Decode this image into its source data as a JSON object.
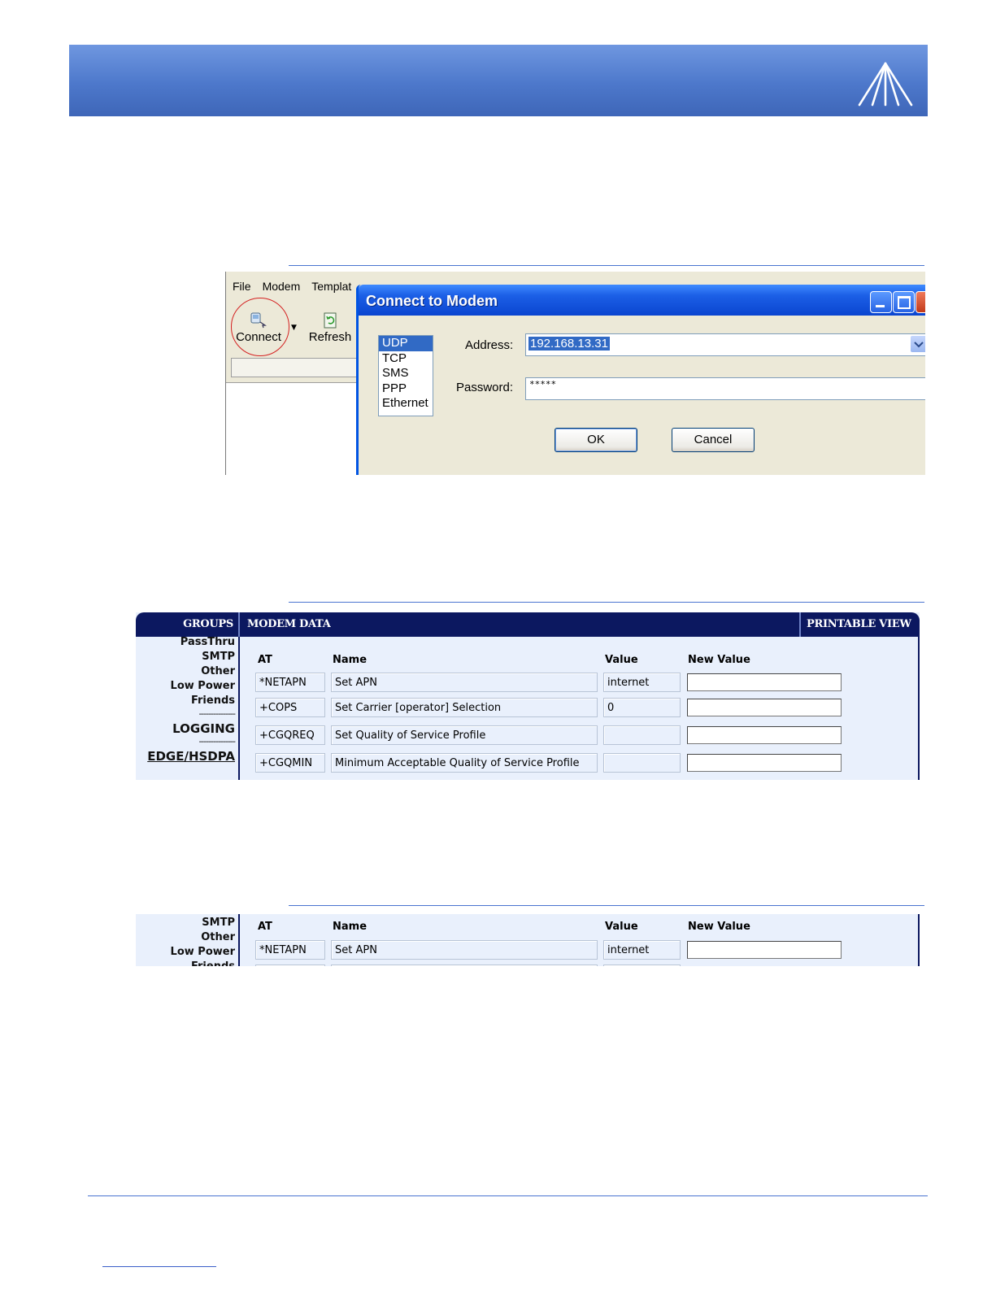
{
  "app": {
    "menu": [
      "File",
      "Modem",
      "Templat"
    ],
    "toolbar": {
      "connect_label": "Connect",
      "refresh_label": "Refresh"
    },
    "dialog": {
      "title": "Connect to Modem",
      "protocols": [
        "UDP",
        "TCP",
        "SMS",
        "PPP",
        "Ethernet"
      ],
      "selected_protocol": "UDP",
      "address_label": "Address:",
      "address_value": "192.168.13.31",
      "password_label": "Password:",
      "password_value": "*****",
      "ok_label": "OK",
      "cancel_label": "Cancel"
    }
  },
  "web1": {
    "header": {
      "groups": "GROUPS",
      "modem_data": "MODEM DATA",
      "printable_view": "PRINTABLE VIEW"
    },
    "sidebar": [
      "PassThru",
      "SMTP",
      "Other",
      "Low Power",
      "Friends"
    ],
    "separator": "---------------",
    "logging": "LOGGING",
    "edge": "EDGE/HSDPA",
    "columns": {
      "at": "AT",
      "name": "Name",
      "value": "Value",
      "new_value": "New Value"
    },
    "rows": [
      {
        "at": "*NETAPN",
        "name": "Set APN",
        "value": "internet",
        "new_value": ""
      },
      {
        "at": "+COPS",
        "name": "Set Carrier [operator] Selection",
        "value": "0",
        "new_value": ""
      },
      {
        "at": "+CGQREQ",
        "name": "Set Quality of Service Profile",
        "value": "",
        "new_value": ""
      },
      {
        "at": "+CGQMIN",
        "name": "Minimum Acceptable Quality of Service Profile",
        "value": "",
        "new_value": ""
      }
    ]
  },
  "web2": {
    "sidebar": [
      "SMTP",
      "Other",
      "Low Power",
      "Friends"
    ],
    "columns": {
      "at": "AT",
      "name": "Name",
      "value": "Value",
      "new_value": "New Value"
    },
    "rows": [
      {
        "at": "*NETAPN",
        "name": "Set APN",
        "value": "internet",
        "new_value": ""
      }
    ]
  }
}
